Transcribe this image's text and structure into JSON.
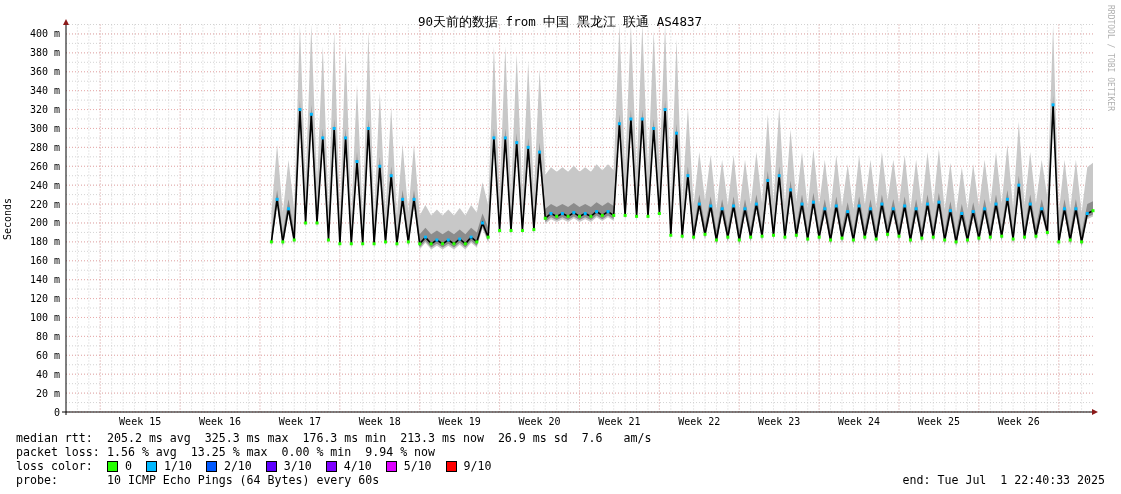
{
  "graph": {
    "credit": "RRDTOOL / TOBI OETIKER",
    "chart_data": {
      "type": "line",
      "title": "90天前的数据 from 中国 黑龙江 联通 AS4837",
      "ylabel": "Seconds",
      "ylim": [
        0,
        410
      ],
      "categories": [
        null,
        null,
        null,
        null,
        null,
        null,
        null,
        null,
        null,
        null,
        null,
        null,
        null,
        "Week 15",
        null,
        null,
        null,
        null,
        null,
        null,
        null,
        null,
        null,
        null,
        null,
        null,
        null,
        "Week 16",
        null,
        null,
        null,
        null,
        null,
        null,
        null,
        null,
        null,
        null,
        null,
        null,
        null,
        "Week 17",
        null,
        null,
        null,
        null,
        null,
        null,
        null,
        null,
        null,
        null,
        null,
        null,
        null,
        "Week 18",
        null,
        null,
        null,
        null,
        null,
        null,
        null,
        null,
        null,
        null,
        null,
        null,
        null,
        "Week 19",
        null,
        null,
        null,
        null,
        null,
        null,
        null,
        null,
        null,
        null,
        null,
        null,
        null,
        "Week 20",
        null,
        null,
        null,
        null,
        null,
        null,
        null,
        null,
        null,
        null,
        null,
        null,
        null,
        "Week 21",
        null,
        null,
        null,
        null,
        null,
        null,
        null,
        null,
        null,
        null,
        null,
        null,
        null,
        "Week 22",
        null,
        null,
        null,
        null,
        null,
        null,
        null,
        null,
        null,
        null,
        null,
        null,
        null,
        "Week 23",
        null,
        null,
        null,
        null,
        null,
        null,
        null,
        null,
        null,
        null,
        null,
        null,
        null,
        "Week 24",
        null,
        null,
        null,
        null,
        null,
        null,
        null,
        null,
        null,
        null,
        null,
        null,
        null,
        "Week 25",
        null,
        null,
        null,
        null,
        null,
        null,
        null,
        null,
        null,
        null,
        null,
        null,
        null,
        "Week 26",
        null,
        null,
        null,
        null,
        null,
        null,
        null,
        null,
        null,
        null,
        null,
        null,
        null
      ],
      "series": [
        {
          "name": "median rtt:",
          "color": "#000000",
          "marker": true,
          "values": [
            null,
            null,
            null,
            null,
            null,
            null,
            null,
            null,
            null,
            null,
            null,
            null,
            null,
            null,
            null,
            null,
            null,
            null,
            null,
            null,
            null,
            null,
            null,
            null,
            null,
            null,
            null,
            null,
            null,
            null,
            null,
            null,
            null,
            null,
            null,
            null,
            180,
            225,
            180,
            215,
            182,
            320,
            200,
            315,
            200,
            290,
            182,
            300,
            178,
            290,
            178,
            265,
            178,
            300,
            178,
            260,
            180,
            250,
            178,
            225,
            180,
            225,
            178,
            185,
            178,
            182,
            178,
            182,
            178,
            183,
            178,
            185,
            180,
            200,
            185,
            290,
            192,
            290,
            192,
            285,
            192,
            280,
            193,
            275,
            205,
            210,
            207,
            210,
            207,
            211,
            207,
            210,
            207,
            212,
            208,
            212,
            208,
            305,
            208,
            310,
            207,
            310,
            207,
            300,
            210,
            320,
            187,
            295,
            186,
            250,
            185,
            220,
            188,
            218,
            182,
            215,
            185,
            218,
            182,
            215,
            185,
            220,
            186,
            245,
            187,
            250,
            185,
            235,
            187,
            220,
            183,
            222,
            185,
            215,
            182,
            218,
            184,
            212,
            182,
            218,
            185,
            215,
            183,
            220,
            188,
            215,
            186,
            218,
            182,
            215,
            184,
            220,
            185,
            222,
            182,
            213,
            180,
            210,
            182,
            212,
            184,
            215,
            185,
            220,
            186,
            225,
            183,
            240,
            185,
            220,
            186,
            215,
            190,
            325,
            180,
            215,
            182,
            215,
            180,
            210,
            213
          ]
        }
      ],
      "yticks": [
        {
          "value": 0,
          "label": "0"
        },
        {
          "value": 20,
          "label": "20 m"
        },
        {
          "value": 40,
          "label": "40 m"
        },
        {
          "value": 60,
          "label": "60 m"
        },
        {
          "value": 80,
          "label": "80 m"
        },
        {
          "value": 100,
          "label": "100 m"
        },
        {
          "value": 120,
          "label": "120 m"
        },
        {
          "value": 140,
          "label": "140 m"
        },
        {
          "value": 160,
          "label": "160 m"
        },
        {
          "value": 180,
          "label": "180 m"
        },
        {
          "value": 200,
          "label": "200 m"
        },
        {
          "value": 220,
          "label": "220 m"
        },
        {
          "value": 240,
          "label": "240 m"
        },
        {
          "value": 260,
          "label": "260 m"
        },
        {
          "value": 280,
          "label": "280 m"
        },
        {
          "value": 300,
          "label": "300 m"
        },
        {
          "value": 320,
          "label": "320 m"
        },
        {
          "value": 340,
          "label": "340 m"
        },
        {
          "value": 360,
          "label": "360 m"
        },
        {
          "value": 380,
          "label": "380 m"
        },
        {
          "value": 400,
          "label": "400 m"
        }
      ],
      "grid": true
    }
  },
  "legend": {
    "median_rtt": {
      "text": "205.2 ms avg  325.3 ms max  176.3 ms min  213.3 ms now  26.9 ms sd  7.6   am/s"
    },
    "packet_loss": {
      "label": "packet loss:",
      "text": "1.56 % avg  13.25 % max  0.00 % min  9.94 % now"
    },
    "loss_color": {
      "label": "loss color:",
      "items": [
        {
          "label": "0",
          "color": "#26ff00"
        },
        {
          "label": "1/10",
          "color": "#00b8ff"
        },
        {
          "label": "2/10",
          "color": "#0059ff"
        },
        {
          "label": "3/10",
          "color": "#5e00ff"
        },
        {
          "label": "4/10",
          "color": "#7e00ff"
        },
        {
          "label": "5/10",
          "color": "#dd00ff"
        },
        {
          "label": "9/10",
          "color": "#ff0000"
        }
      ]
    },
    "probe": {
      "label": "probe:",
      "text": "10 ICMP Echo Pings (64 Bytes) every 60s"
    },
    "end": "end: Tue Jul  1 22:40:33 2025"
  }
}
